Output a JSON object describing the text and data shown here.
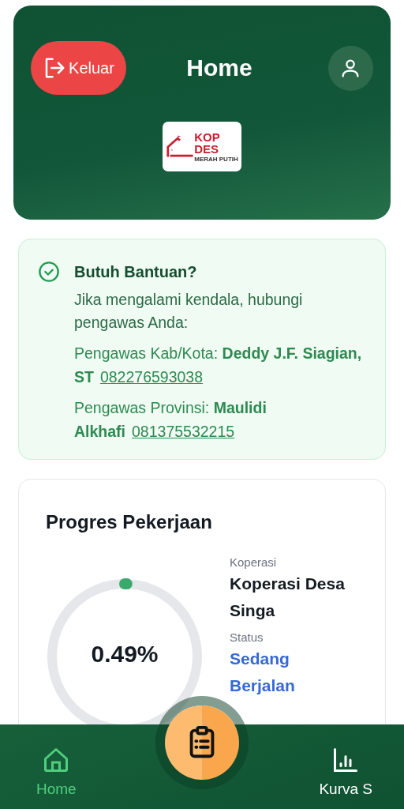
{
  "header": {
    "logout_button": {
      "label": "Keluar"
    },
    "title": "Home",
    "logo": {
      "line_1": "KOP",
      "line_2": "DES",
      "tagline": "MERAH PUTIH"
    }
  },
  "help_card": {
    "title": "Butuh Bantuan?",
    "message": "Jika mengalami kendala, hubungi pengawas Anda:",
    "contacts": [
      {
        "text": "Pengawas Kab/Kota: **Deddy J.F. Siagian, ST**",
        "phone": "082276593038"
      },
      {
        "text": "Pengawas Provinsi: **Maulidi Alkhafi**",
        "phone": "081375532215"
      }
    ]
  },
  "progress_card": {
    "title": "Progres Pekerjaan",
    "percent": "0.49%",
    "level": 0.0049,
    "fields": [
      {
        "label": "Koperasi",
        "value": "Koperasi Desa Singa",
        "kind": "plain"
      },
      {
        "label": "Status",
        "value": "Sedang Berjalan",
        "kind": "status"
      }
    ]
  },
  "bottom_nav": {
    "items": [
      {
        "label": "Home",
        "kind": "home",
        "selected": true
      },
      {
        "label": "Kurva S",
        "kind": "chart",
        "selected": false
      }
    ]
  }
}
